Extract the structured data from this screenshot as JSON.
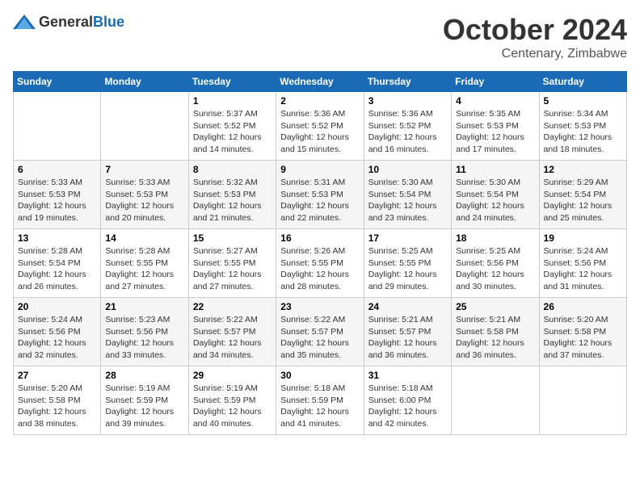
{
  "logo": {
    "general": "General",
    "blue": "Blue"
  },
  "header": {
    "month": "October 2024",
    "location": "Centenary, Zimbabwe"
  },
  "weekdays": [
    "Sunday",
    "Monday",
    "Tuesday",
    "Wednesday",
    "Thursday",
    "Friday",
    "Saturday"
  ],
  "weeks": [
    [
      {
        "day": "",
        "info": ""
      },
      {
        "day": "",
        "info": ""
      },
      {
        "day": "1",
        "info": "Sunrise: 5:37 AM\nSunset: 5:52 PM\nDaylight: 12 hours and 14 minutes."
      },
      {
        "day": "2",
        "info": "Sunrise: 5:36 AM\nSunset: 5:52 PM\nDaylight: 12 hours and 15 minutes."
      },
      {
        "day": "3",
        "info": "Sunrise: 5:36 AM\nSunset: 5:52 PM\nDaylight: 12 hours and 16 minutes."
      },
      {
        "day": "4",
        "info": "Sunrise: 5:35 AM\nSunset: 5:53 PM\nDaylight: 12 hours and 17 minutes."
      },
      {
        "day": "5",
        "info": "Sunrise: 5:34 AM\nSunset: 5:53 PM\nDaylight: 12 hours and 18 minutes."
      }
    ],
    [
      {
        "day": "6",
        "info": "Sunrise: 5:33 AM\nSunset: 5:53 PM\nDaylight: 12 hours and 19 minutes."
      },
      {
        "day": "7",
        "info": "Sunrise: 5:33 AM\nSunset: 5:53 PM\nDaylight: 12 hours and 20 minutes."
      },
      {
        "day": "8",
        "info": "Sunrise: 5:32 AM\nSunset: 5:53 PM\nDaylight: 12 hours and 21 minutes."
      },
      {
        "day": "9",
        "info": "Sunrise: 5:31 AM\nSunset: 5:53 PM\nDaylight: 12 hours and 22 minutes."
      },
      {
        "day": "10",
        "info": "Sunrise: 5:30 AM\nSunset: 5:54 PM\nDaylight: 12 hours and 23 minutes."
      },
      {
        "day": "11",
        "info": "Sunrise: 5:30 AM\nSunset: 5:54 PM\nDaylight: 12 hours and 24 minutes."
      },
      {
        "day": "12",
        "info": "Sunrise: 5:29 AM\nSunset: 5:54 PM\nDaylight: 12 hours and 25 minutes."
      }
    ],
    [
      {
        "day": "13",
        "info": "Sunrise: 5:28 AM\nSunset: 5:54 PM\nDaylight: 12 hours and 26 minutes."
      },
      {
        "day": "14",
        "info": "Sunrise: 5:28 AM\nSunset: 5:55 PM\nDaylight: 12 hours and 27 minutes."
      },
      {
        "day": "15",
        "info": "Sunrise: 5:27 AM\nSunset: 5:55 PM\nDaylight: 12 hours and 27 minutes."
      },
      {
        "day": "16",
        "info": "Sunrise: 5:26 AM\nSunset: 5:55 PM\nDaylight: 12 hours and 28 minutes."
      },
      {
        "day": "17",
        "info": "Sunrise: 5:25 AM\nSunset: 5:55 PM\nDaylight: 12 hours and 29 minutes."
      },
      {
        "day": "18",
        "info": "Sunrise: 5:25 AM\nSunset: 5:56 PM\nDaylight: 12 hours and 30 minutes."
      },
      {
        "day": "19",
        "info": "Sunrise: 5:24 AM\nSunset: 5:56 PM\nDaylight: 12 hours and 31 minutes."
      }
    ],
    [
      {
        "day": "20",
        "info": "Sunrise: 5:24 AM\nSunset: 5:56 PM\nDaylight: 12 hours and 32 minutes."
      },
      {
        "day": "21",
        "info": "Sunrise: 5:23 AM\nSunset: 5:56 PM\nDaylight: 12 hours and 33 minutes."
      },
      {
        "day": "22",
        "info": "Sunrise: 5:22 AM\nSunset: 5:57 PM\nDaylight: 12 hours and 34 minutes."
      },
      {
        "day": "23",
        "info": "Sunrise: 5:22 AM\nSunset: 5:57 PM\nDaylight: 12 hours and 35 minutes."
      },
      {
        "day": "24",
        "info": "Sunrise: 5:21 AM\nSunset: 5:57 PM\nDaylight: 12 hours and 36 minutes."
      },
      {
        "day": "25",
        "info": "Sunrise: 5:21 AM\nSunset: 5:58 PM\nDaylight: 12 hours and 36 minutes."
      },
      {
        "day": "26",
        "info": "Sunrise: 5:20 AM\nSunset: 5:58 PM\nDaylight: 12 hours and 37 minutes."
      }
    ],
    [
      {
        "day": "27",
        "info": "Sunrise: 5:20 AM\nSunset: 5:58 PM\nDaylight: 12 hours and 38 minutes."
      },
      {
        "day": "28",
        "info": "Sunrise: 5:19 AM\nSunset: 5:59 PM\nDaylight: 12 hours and 39 minutes."
      },
      {
        "day": "29",
        "info": "Sunrise: 5:19 AM\nSunset: 5:59 PM\nDaylight: 12 hours and 40 minutes."
      },
      {
        "day": "30",
        "info": "Sunrise: 5:18 AM\nSunset: 5:59 PM\nDaylight: 12 hours and 41 minutes."
      },
      {
        "day": "31",
        "info": "Sunrise: 5:18 AM\nSunset: 6:00 PM\nDaylight: 12 hours and 42 minutes."
      },
      {
        "day": "",
        "info": ""
      },
      {
        "day": "",
        "info": ""
      }
    ]
  ]
}
